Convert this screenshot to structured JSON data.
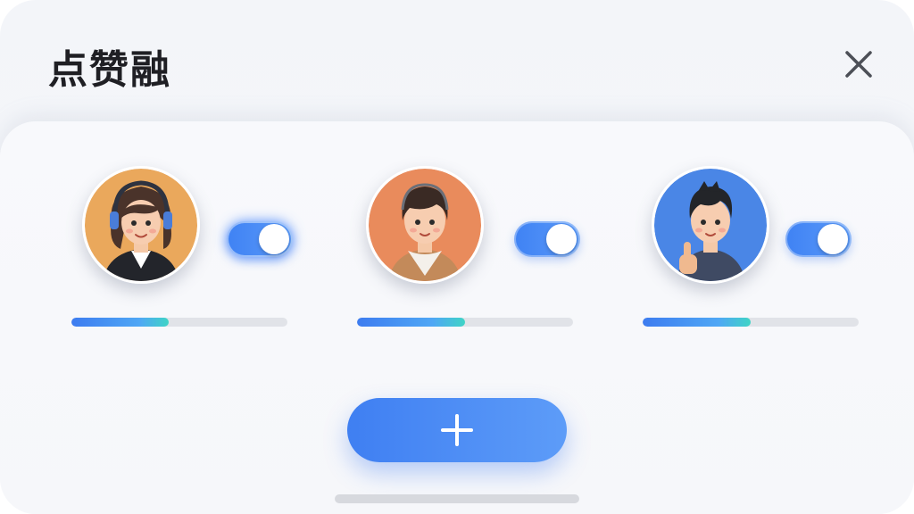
{
  "header": {
    "title": "点赞融",
    "close_icon": "close-icon"
  },
  "members": [
    {
      "name": "member-1",
      "avatar_bg": "#eaa85c",
      "toggle_on": true,
      "highlighted": true,
      "progress": 0.45
    },
    {
      "name": "member-2",
      "avatar_bg": "#e98b5c",
      "toggle_on": true,
      "highlighted": false,
      "progress": 0.5
    },
    {
      "name": "member-3",
      "avatar_bg": "#4a86e6",
      "toggle_on": true,
      "highlighted": false,
      "progress": 0.5
    }
  ],
  "actions": {
    "add_icon": "plus-icon"
  },
  "colors": {
    "accent": "#3f82f4",
    "progress_end": "#3fd4c6",
    "track": "#e1e3e8"
  }
}
